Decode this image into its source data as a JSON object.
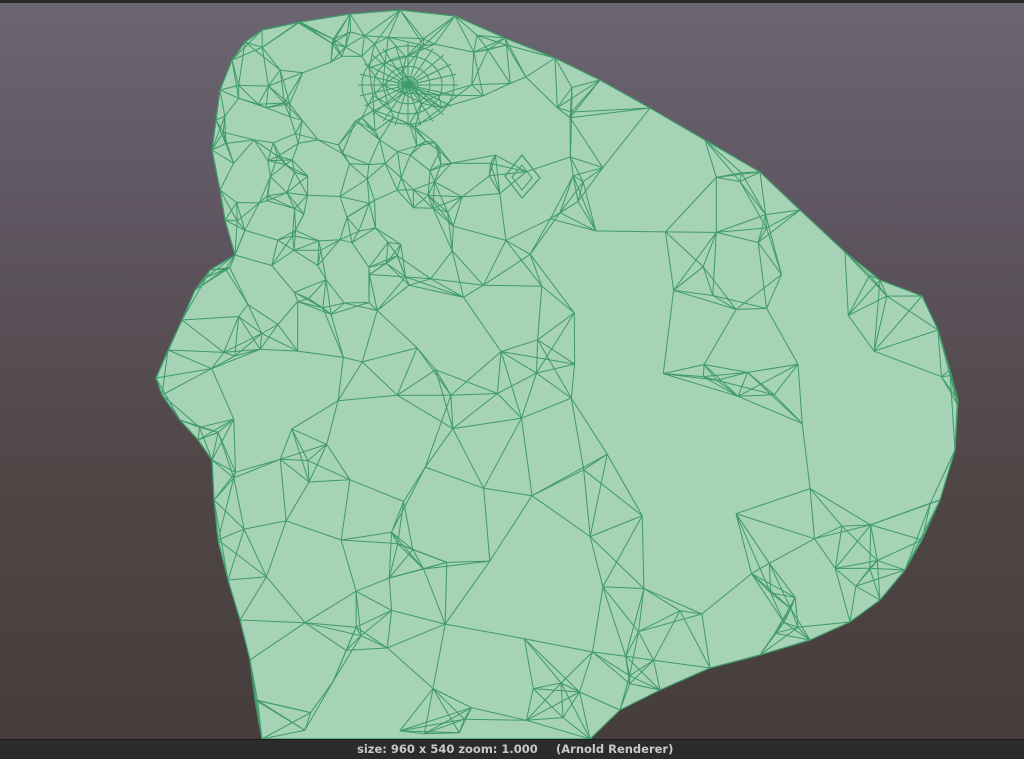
{
  "viewport": {
    "mesh_fill": "#a6d2b5",
    "wire_color": "#3f9a6a"
  },
  "status_bar": {
    "size_zoom": "size: 960 x 540 zoom: 1.000",
    "renderer": "(Arnold Renderer)"
  }
}
